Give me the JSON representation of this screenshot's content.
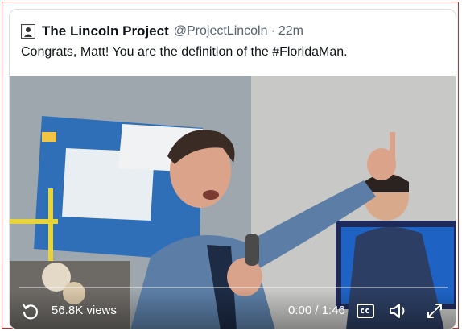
{
  "tweet": {
    "display_name": "The Lincoln Project",
    "handle": "@ProjectLincoln",
    "separator": "·",
    "time": "22m",
    "text": "Congrats, Matt! You are the definition of the #FloridaMan."
  },
  "video": {
    "views": "56.8K views",
    "time_readout": "0:00 / 1:46",
    "icons": [
      "replay-icon",
      "closed-captions-icon",
      "volume-icon",
      "fullscreen-icon"
    ]
  },
  "colors": {
    "frame_border": "#c62828",
    "name_text": "#0f1419",
    "secondary_text": "#566370"
  }
}
